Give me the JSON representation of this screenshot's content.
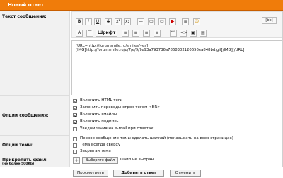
{
  "window": {
    "title": "Новый ответ"
  },
  "labels": {
    "message_text": "Текст сообщения:",
    "message_options": "Опции сообщения:",
    "topic_options": "Опции темы:",
    "attach_file": "Прикрепить файл:",
    "attach_note": "(не более 500Kb)"
  },
  "toolbar": {
    "row1": [
      "B",
      "I",
      "U",
      "S",
      "x²",
      "x₂",
      "—",
      "▭",
      "▭",
      "▶",
      "≡",
      "☺"
    ],
    "row2": [
      "A",
      "▔",
      "Шрифт",
      "≡",
      "≡",
      "≡",
      "≡",
      "“”",
      "<>",
      "▣",
      "▤"
    ],
    "bb_label": "[bb]"
  },
  "editor": {
    "lines": [
      "[URL=http://forumsmile.ru/smiles/yes]",
      "[IMG]http://forumsmile.ru/u/7/e/9/7e93a793736a7868302120656ea848bd.gif[/IMG][/URL]"
    ]
  },
  "message_options": [
    {
      "label": "Включить HTML теги",
      "checked": true
    },
    {
      "label": "Заменить переводы строк тегом <BR>",
      "checked": true
    },
    {
      "label": "Включить смайлы",
      "checked": true
    },
    {
      "label": "Включить подпись",
      "checked": true
    },
    {
      "label": "Уведомления на e-mail при ответах",
      "checked": false
    }
  ],
  "topic_options": [
    {
      "label": "Первое сообщение темы сделать шапкой (показывать на всех страницах)",
      "checked": false
    },
    {
      "label": "Тема всегда сверху",
      "checked": false
    },
    {
      "label": "Закрытая тема",
      "checked": false
    }
  ],
  "file": {
    "add_label": "+",
    "choose_label": "Выберите файл",
    "status": "Файл не выбран"
  },
  "buttons": {
    "preview": "Просмотреть",
    "submit": "Добавить ответ",
    "cancel": "Отменить"
  },
  "colors": {
    "header": "#f07c0a",
    "label_bg": "#f1f1f1"
  }
}
